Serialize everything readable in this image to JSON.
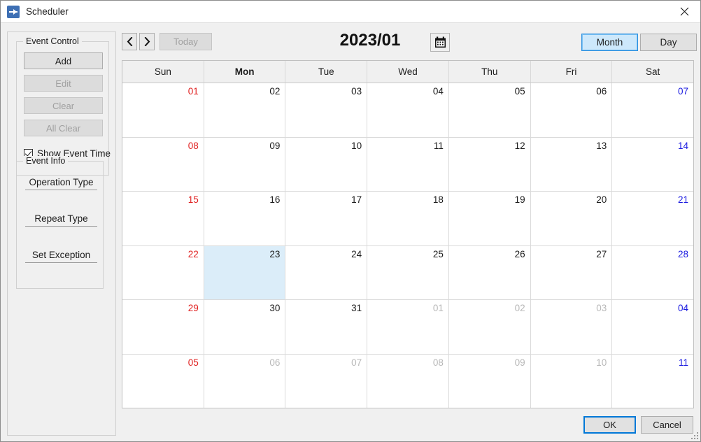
{
  "window": {
    "title": "Scheduler",
    "icon": "scheduler-icon",
    "close_icon": "close-icon"
  },
  "sidebar": {
    "event_control": {
      "title": "Event Control",
      "buttons": [
        {
          "label": "Add",
          "enabled": true
        },
        {
          "label": "Edit",
          "enabled": false
        },
        {
          "label": "Clear",
          "enabled": false
        },
        {
          "label": "All Clear",
          "enabled": false
        }
      ],
      "checkbox": {
        "label": "Show Event Time",
        "checked": true
      }
    },
    "event_info": {
      "title": "Event Info",
      "links": [
        {
          "label": "Operation Type"
        },
        {
          "label": "Repeat Type"
        },
        {
          "label": "Set Exception"
        }
      ]
    }
  },
  "toolbar": {
    "prev_icon": "chevron-left-icon",
    "next_icon": "chevron-right-icon",
    "today_label": "Today",
    "today_enabled": false,
    "month_label": "2023/01",
    "calendar_picker_icon": "calendar-icon",
    "views": [
      {
        "label": "Month",
        "active": true
      },
      {
        "label": "Day",
        "active": false
      }
    ]
  },
  "calendar": {
    "weekdays": [
      {
        "label": "Sun",
        "selected": false
      },
      {
        "label": "Mon",
        "selected": true
      },
      {
        "label": "Tue",
        "selected": false
      },
      {
        "label": "Wed",
        "selected": false
      },
      {
        "label": "Thu",
        "selected": false
      },
      {
        "label": "Fri",
        "selected": false
      },
      {
        "label": "Sat",
        "selected": false
      }
    ],
    "selected_date": "23",
    "weeks": [
      [
        {
          "day": "01",
          "kind": "sun",
          "current": true,
          "selected": false
        },
        {
          "day": "02",
          "kind": "wk",
          "current": true,
          "selected": false
        },
        {
          "day": "03",
          "kind": "wk",
          "current": true,
          "selected": false
        },
        {
          "day": "04",
          "kind": "wk",
          "current": true,
          "selected": false
        },
        {
          "day": "05",
          "kind": "wk",
          "current": true,
          "selected": false
        },
        {
          "day": "06",
          "kind": "wk",
          "current": true,
          "selected": false
        },
        {
          "day": "07",
          "kind": "sat",
          "current": true,
          "selected": false
        }
      ],
      [
        {
          "day": "08",
          "kind": "sun",
          "current": true,
          "selected": false
        },
        {
          "day": "09",
          "kind": "wk",
          "current": true,
          "selected": false
        },
        {
          "day": "10",
          "kind": "wk",
          "current": true,
          "selected": false
        },
        {
          "day": "11",
          "kind": "wk",
          "current": true,
          "selected": false
        },
        {
          "day": "12",
          "kind": "wk",
          "current": true,
          "selected": false
        },
        {
          "day": "13",
          "kind": "wk",
          "current": true,
          "selected": false
        },
        {
          "day": "14",
          "kind": "sat",
          "current": true,
          "selected": false
        }
      ],
      [
        {
          "day": "15",
          "kind": "sun",
          "current": true,
          "selected": false
        },
        {
          "day": "16",
          "kind": "wk",
          "current": true,
          "selected": false
        },
        {
          "day": "17",
          "kind": "wk",
          "current": true,
          "selected": false
        },
        {
          "day": "18",
          "kind": "wk",
          "current": true,
          "selected": false
        },
        {
          "day": "19",
          "kind": "wk",
          "current": true,
          "selected": false
        },
        {
          "day": "20",
          "kind": "wk",
          "current": true,
          "selected": false
        },
        {
          "day": "21",
          "kind": "sat",
          "current": true,
          "selected": false
        }
      ],
      [
        {
          "day": "22",
          "kind": "sun",
          "current": true,
          "selected": false
        },
        {
          "day": "23",
          "kind": "wk",
          "current": true,
          "selected": true
        },
        {
          "day": "24",
          "kind": "wk",
          "current": true,
          "selected": false
        },
        {
          "day": "25",
          "kind": "wk",
          "current": true,
          "selected": false
        },
        {
          "day": "26",
          "kind": "wk",
          "current": true,
          "selected": false
        },
        {
          "day": "27",
          "kind": "wk",
          "current": true,
          "selected": false
        },
        {
          "day": "28",
          "kind": "sat",
          "current": true,
          "selected": false
        }
      ],
      [
        {
          "day": "29",
          "kind": "sun",
          "current": true,
          "selected": false
        },
        {
          "day": "30",
          "kind": "wk",
          "current": true,
          "selected": false
        },
        {
          "day": "31",
          "kind": "wk",
          "current": true,
          "selected": false
        },
        {
          "day": "01",
          "kind": "wk",
          "current": false,
          "selected": false
        },
        {
          "day": "02",
          "kind": "wk",
          "current": false,
          "selected": false
        },
        {
          "day": "03",
          "kind": "wk",
          "current": false,
          "selected": false
        },
        {
          "day": "04",
          "kind": "sat",
          "current": false,
          "selected": false
        }
      ],
      [
        {
          "day": "05",
          "kind": "sun",
          "current": false,
          "selected": false
        },
        {
          "day": "06",
          "kind": "wk",
          "current": false,
          "selected": false
        },
        {
          "day": "07",
          "kind": "wk",
          "current": false,
          "selected": false
        },
        {
          "day": "08",
          "kind": "wk",
          "current": false,
          "selected": false
        },
        {
          "day": "09",
          "kind": "wk",
          "current": false,
          "selected": false
        },
        {
          "day": "10",
          "kind": "wk",
          "current": false,
          "selected": false
        },
        {
          "day": "11",
          "kind": "sat",
          "current": false,
          "selected": false
        }
      ]
    ]
  },
  "footer": {
    "ok_label": "OK",
    "cancel_label": "Cancel"
  },
  "colors": {
    "sunday": "#e02020",
    "saturday": "#1a1ae0",
    "other_month": "#b8b8b8",
    "selected_cell": "#dbedf9",
    "accent": "#0078d7"
  }
}
